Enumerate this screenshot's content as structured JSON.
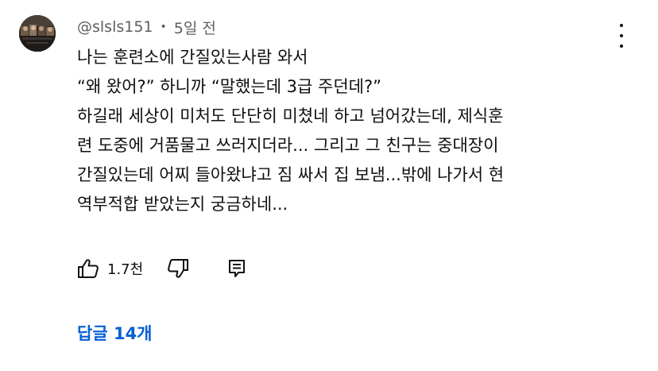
{
  "comment": {
    "author": "@slsls151",
    "separator": "•",
    "timestamp": "5일 전",
    "avatar_icon": "user-avatar-photo",
    "text_lines": [
      "나는 훈련소에 간질있는사람 와서",
      "“왜 왔어?” 하니까  “말했는데 3급 주던데?”",
      "하길래 세상이 미처도 단단히 미쳤네 하고 넘어갔는데, 제식훈",
      "련 도중에 거품물고 쓰러지더라... 그리고 그 친구는 중대장이",
      "간질있는데 어찌 들아왔냐고 짐 싸서 집 보냄...밖에 나가서 현",
      "역부적합 받았는지 궁금하네..."
    ],
    "like_count": "1.7천",
    "replies_label": "답글 14개"
  },
  "icons": {
    "more": "more-vertical-icon",
    "like": "thumbs-up-icon",
    "dislike": "thumbs-down-icon",
    "reply": "reply-comment-icon"
  },
  "colors": {
    "text": "#0f0f0f",
    "meta": "#606060",
    "link": "#065fd4",
    "background": "#ffffff"
  }
}
